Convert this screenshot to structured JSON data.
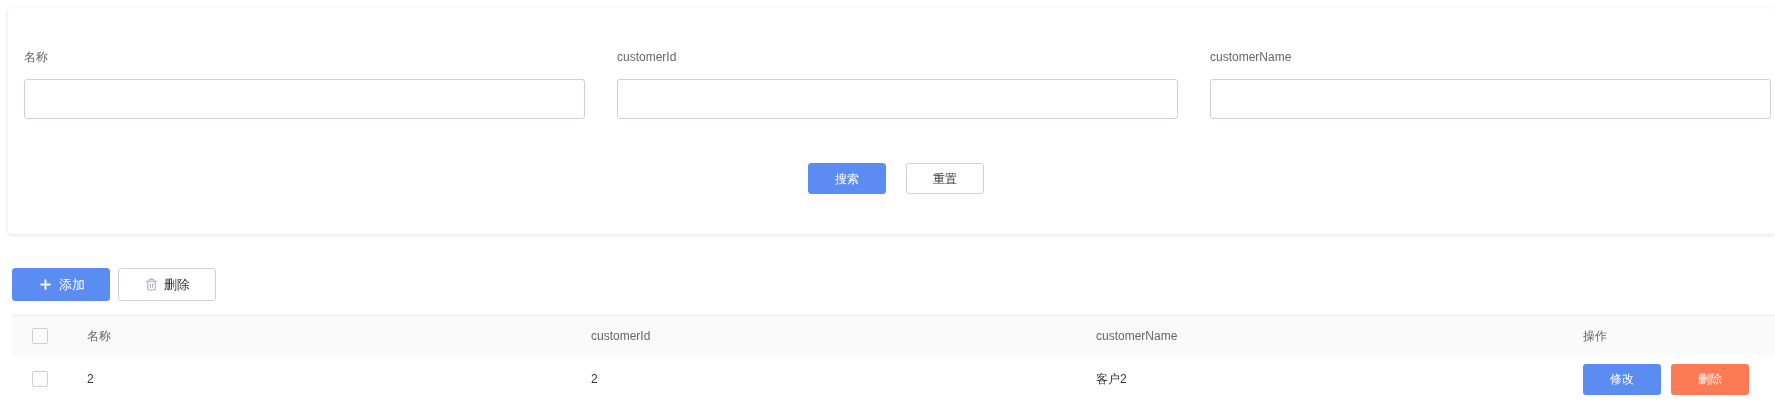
{
  "search_form": {
    "fields": [
      {
        "label": "名称"
      },
      {
        "label": "customerId"
      },
      {
        "label": "customerName"
      }
    ],
    "buttons": [
      {
        "label": "搜索",
        "kind": "primary"
      },
      {
        "label": "重置",
        "kind": "default"
      }
    ]
  },
  "toolbar": [
    {
      "label": "添加",
      "kind": "add"
    },
    {
      "label": "删除",
      "kind": "delete"
    }
  ],
  "table": {
    "select_all": {
      "checked": false
    },
    "columns": [
      "名称",
      "customerId",
      "customerName",
      "操作"
    ],
    "rows": [
      {
        "checked": false,
        "cells": [
          "2",
          "2",
          "客户2"
        ],
        "actions": [
          {
            "label": "修改",
            "kind": "edit"
          },
          {
            "label": "删除",
            "kind": "delete"
          }
        ]
      }
    ]
  }
}
